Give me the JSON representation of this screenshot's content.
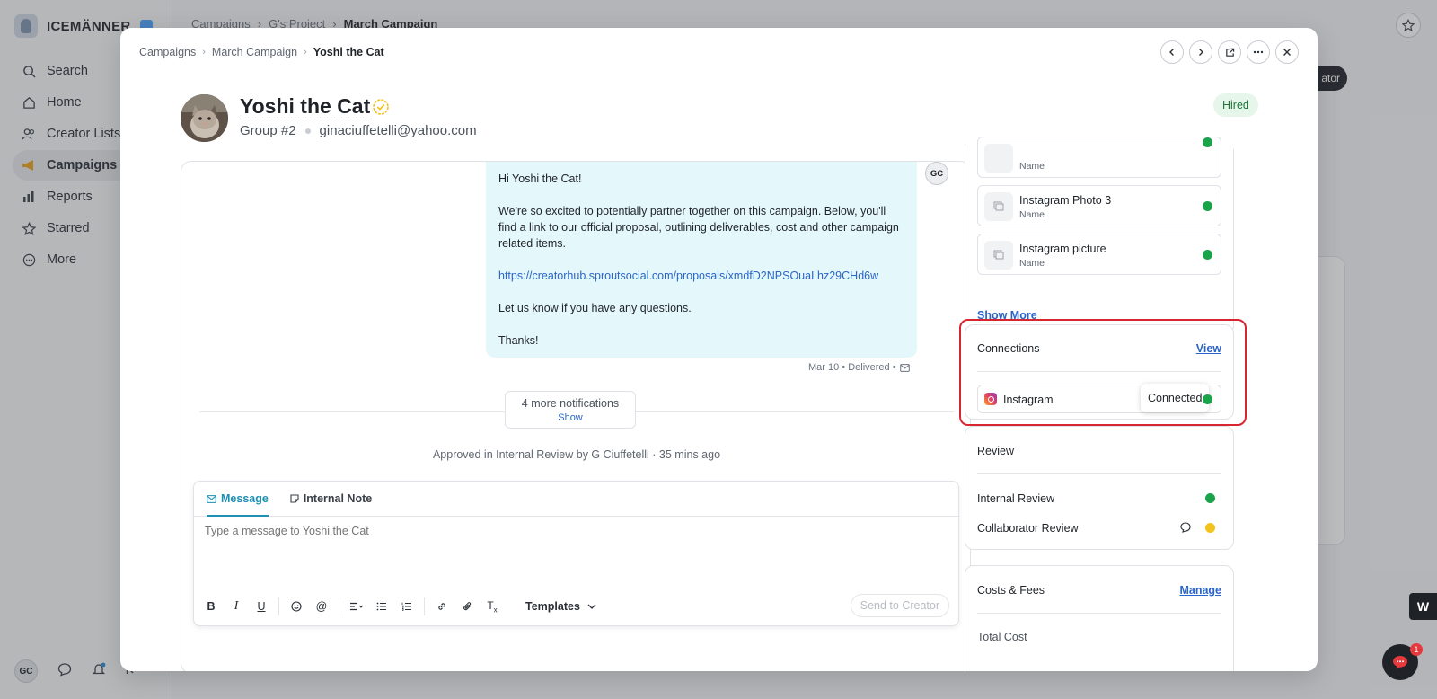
{
  "app": {
    "brand_name": "ICEMÄNNER",
    "nav": [
      {
        "label": "Search",
        "icon": "search-icon"
      },
      {
        "label": "Home",
        "icon": "home-icon"
      },
      {
        "label": "Creator Lists",
        "icon": "users-icon"
      },
      {
        "label": "Campaigns",
        "icon": "megaphone-icon",
        "active": true
      },
      {
        "label": "Reports",
        "icon": "bar-chart-icon"
      },
      {
        "label": "Starred",
        "icon": "star-icon"
      },
      {
        "label": "More",
        "icon": "more-circle-icon"
      }
    ],
    "user_initials": "GC",
    "bg_breadcrumb": [
      "Campaigns",
      "G's Project",
      "March Campaign"
    ],
    "bg_pill_label": "ator"
  },
  "modal": {
    "breadcrumb": [
      "Campaigns",
      "March Campaign",
      "Yoshi the Cat"
    ],
    "creator": {
      "name": "Yoshi the Cat",
      "group": "Group #2",
      "email": "ginaciuffetelli@yahoo.com",
      "status": "Hired"
    },
    "conversation": {
      "sender_initials": "GC",
      "message": {
        "greeting": "Hi Yoshi the Cat!",
        "body": "We're so excited to potentially partner together on this campaign. Below, you'll find a link to our official proposal, outlining deliverables, cost and other campaign related items.",
        "link": "https://creatorhub.sproutsocial.com/proposals/xmdfD2NPSOuaLhz29CHd6w",
        "question": "Let us know if you have any questions.",
        "signoff": "Thanks!"
      },
      "meta": "Mar 10 • Delivered •",
      "notifications": {
        "count_label": "4 more notifications",
        "action": "Show"
      },
      "approved_line": "Approved in Internal Review by G Ciuffetelli · 35 mins ago"
    },
    "composer": {
      "tabs": [
        {
          "label": "Message",
          "icon": "mail-icon",
          "active": true
        },
        {
          "label": "Internal Note",
          "icon": "note-icon",
          "active": false
        }
      ],
      "placeholder": "Type a message to Yoshi the Cat",
      "templates_label": "Templates",
      "send_label": "Send to Creator"
    },
    "assets": {
      "items": [
        {
          "title": "",
          "subtitle": "Name",
          "status": "green"
        },
        {
          "title": "Instagram Photo 3",
          "subtitle": "Name",
          "status": "green"
        },
        {
          "title": "Instagram picture",
          "subtitle": "Name",
          "status": "green"
        }
      ],
      "show_more": "Show More"
    },
    "connections": {
      "title": "Connections",
      "link": "View",
      "item": {
        "label": "Instagram",
        "tooltip": "Connected",
        "status": "green"
      }
    },
    "review": {
      "title": "Review",
      "rows": [
        {
          "label": "Internal Review",
          "status": "green"
        },
        {
          "label": "Collaborator Review",
          "status": "yellow"
        }
      ]
    },
    "costs": {
      "title": "Costs & Fees",
      "link": "Manage",
      "total_label": "Total Cost"
    }
  },
  "floating": {
    "chat_badge": "1",
    "widget_letter": "W"
  },
  "colors": {
    "accent": "#1f8fb3",
    "link": "#2a65c9",
    "success": "#1aa34a",
    "warning": "#f2c31c",
    "highlight": "#d7262f"
  }
}
